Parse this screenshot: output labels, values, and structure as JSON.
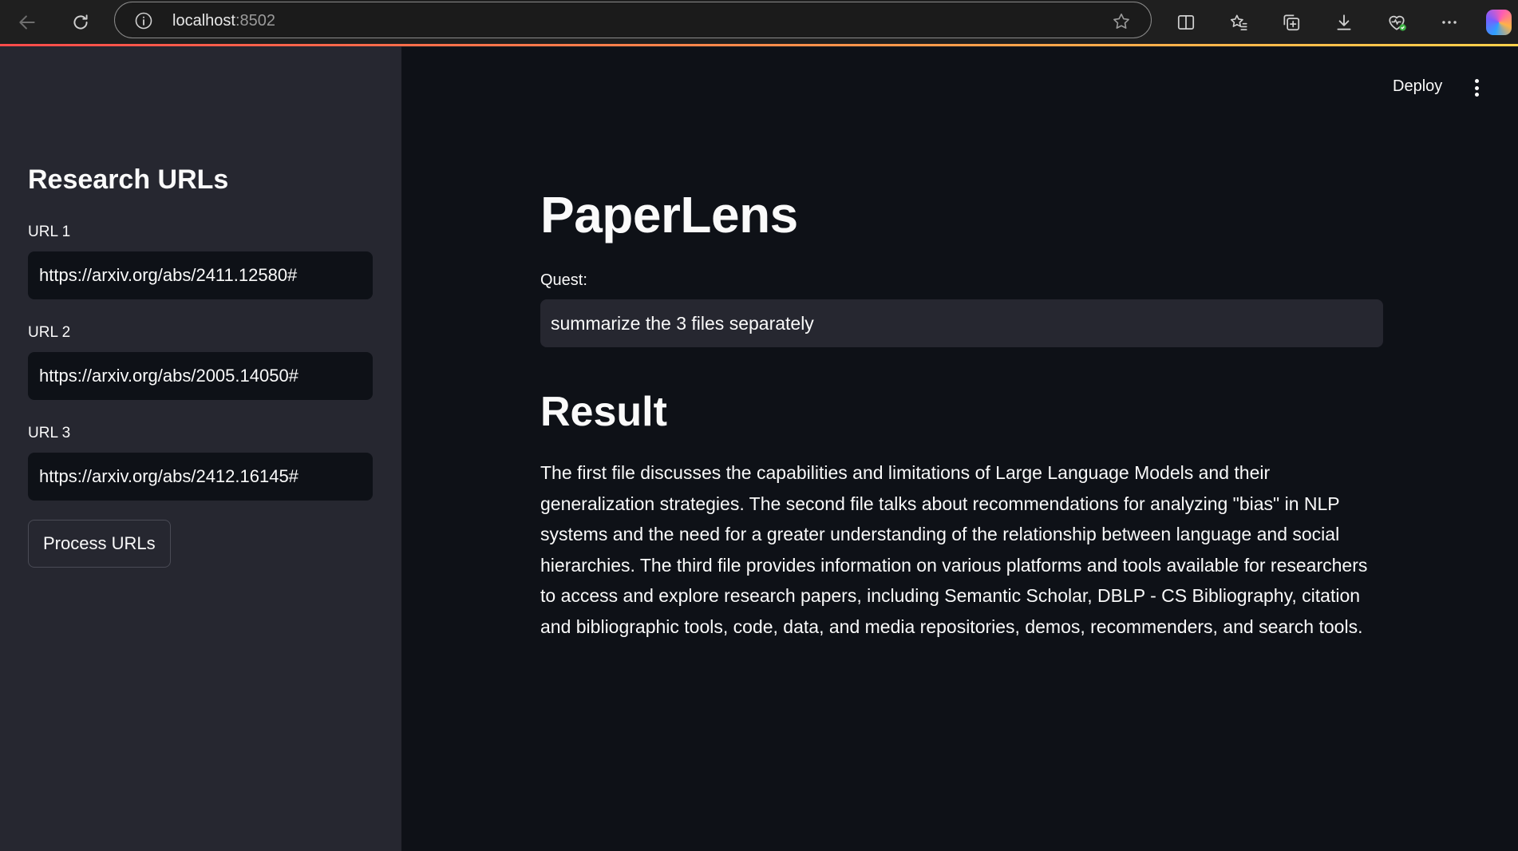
{
  "browser": {
    "url_host": "localhost",
    "url_port": ":8502"
  },
  "header": {
    "deploy_label": "Deploy"
  },
  "sidebar": {
    "title": "Research URLs",
    "fields": [
      {
        "label": "URL 1",
        "value": "https://arxiv.org/abs/2411.12580#"
      },
      {
        "label": "URL 2",
        "value": "https://arxiv.org/abs/2005.14050#"
      },
      {
        "label": "URL 3",
        "value": "https://arxiv.org/abs/2412.16145#"
      }
    ],
    "process_label": "Process URLs"
  },
  "main": {
    "title": "PaperLens",
    "quest_label": "Quest:",
    "quest_value": "summarize the 3 files separately",
    "result_heading": "Result",
    "result_text": "The first file discusses the capabilities and limitations of Large Language Models and their generalization strategies. The second file talks about recommendations for analyzing \"bias\" in NLP systems and the need for a greater understanding of the relationship between language and social hierarchies. The third file provides information on various platforms and tools available for researchers to access and explore research papers, including Semantic Scholar, DBLP - CS Bibliography, citation and bibliographic tools, code, data, and media repositories, demos, recommenders, and search tools."
  },
  "colors": {
    "main_bg": "#0e1117",
    "sidebar_bg": "#262730",
    "accent": "#ff4b4b"
  }
}
